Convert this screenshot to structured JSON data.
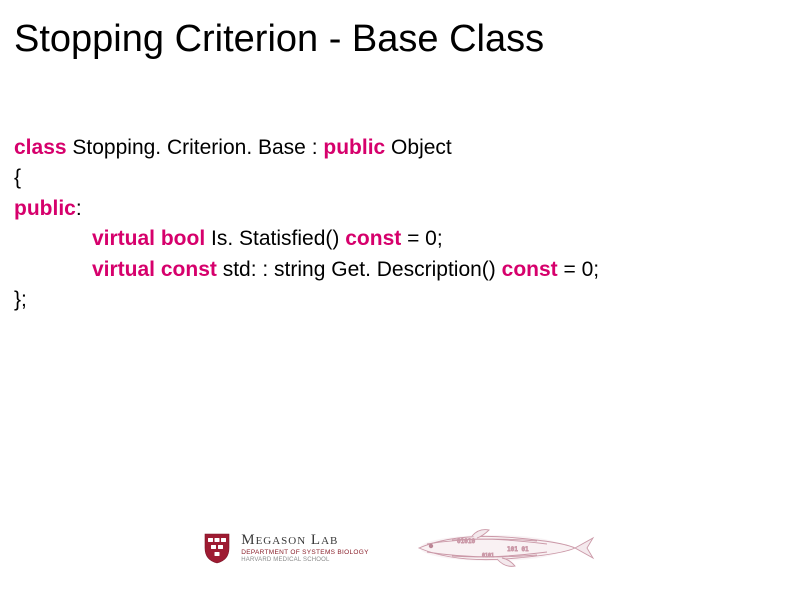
{
  "title": "Stopping Criterion - Base Class",
  "code": {
    "l1": {
      "kw1": "class",
      "t1": " Stopping. Criterion. Base : ",
      "kw2": "public",
      "t2": " Object"
    },
    "l2": "{",
    "l3": {
      "kw1": "public",
      "t1": ":"
    },
    "l4": {
      "kw1": "virtual bool",
      "t1": " Is. Statisfied() ",
      "kw2": "const",
      "t2": " = 0;"
    },
    "l5": {
      "kw1": "virtual const",
      "t1": " std: : string Get. Description() ",
      "kw2": "const",
      "t2": " = 0;"
    },
    "l6": "};"
  },
  "footer": {
    "lab_name": "Megason Lab",
    "dept": "DEPARTMENT OF SYSTEMS BIOLOGY",
    "school": "HARVARD MEDICAL SCHOOL"
  }
}
